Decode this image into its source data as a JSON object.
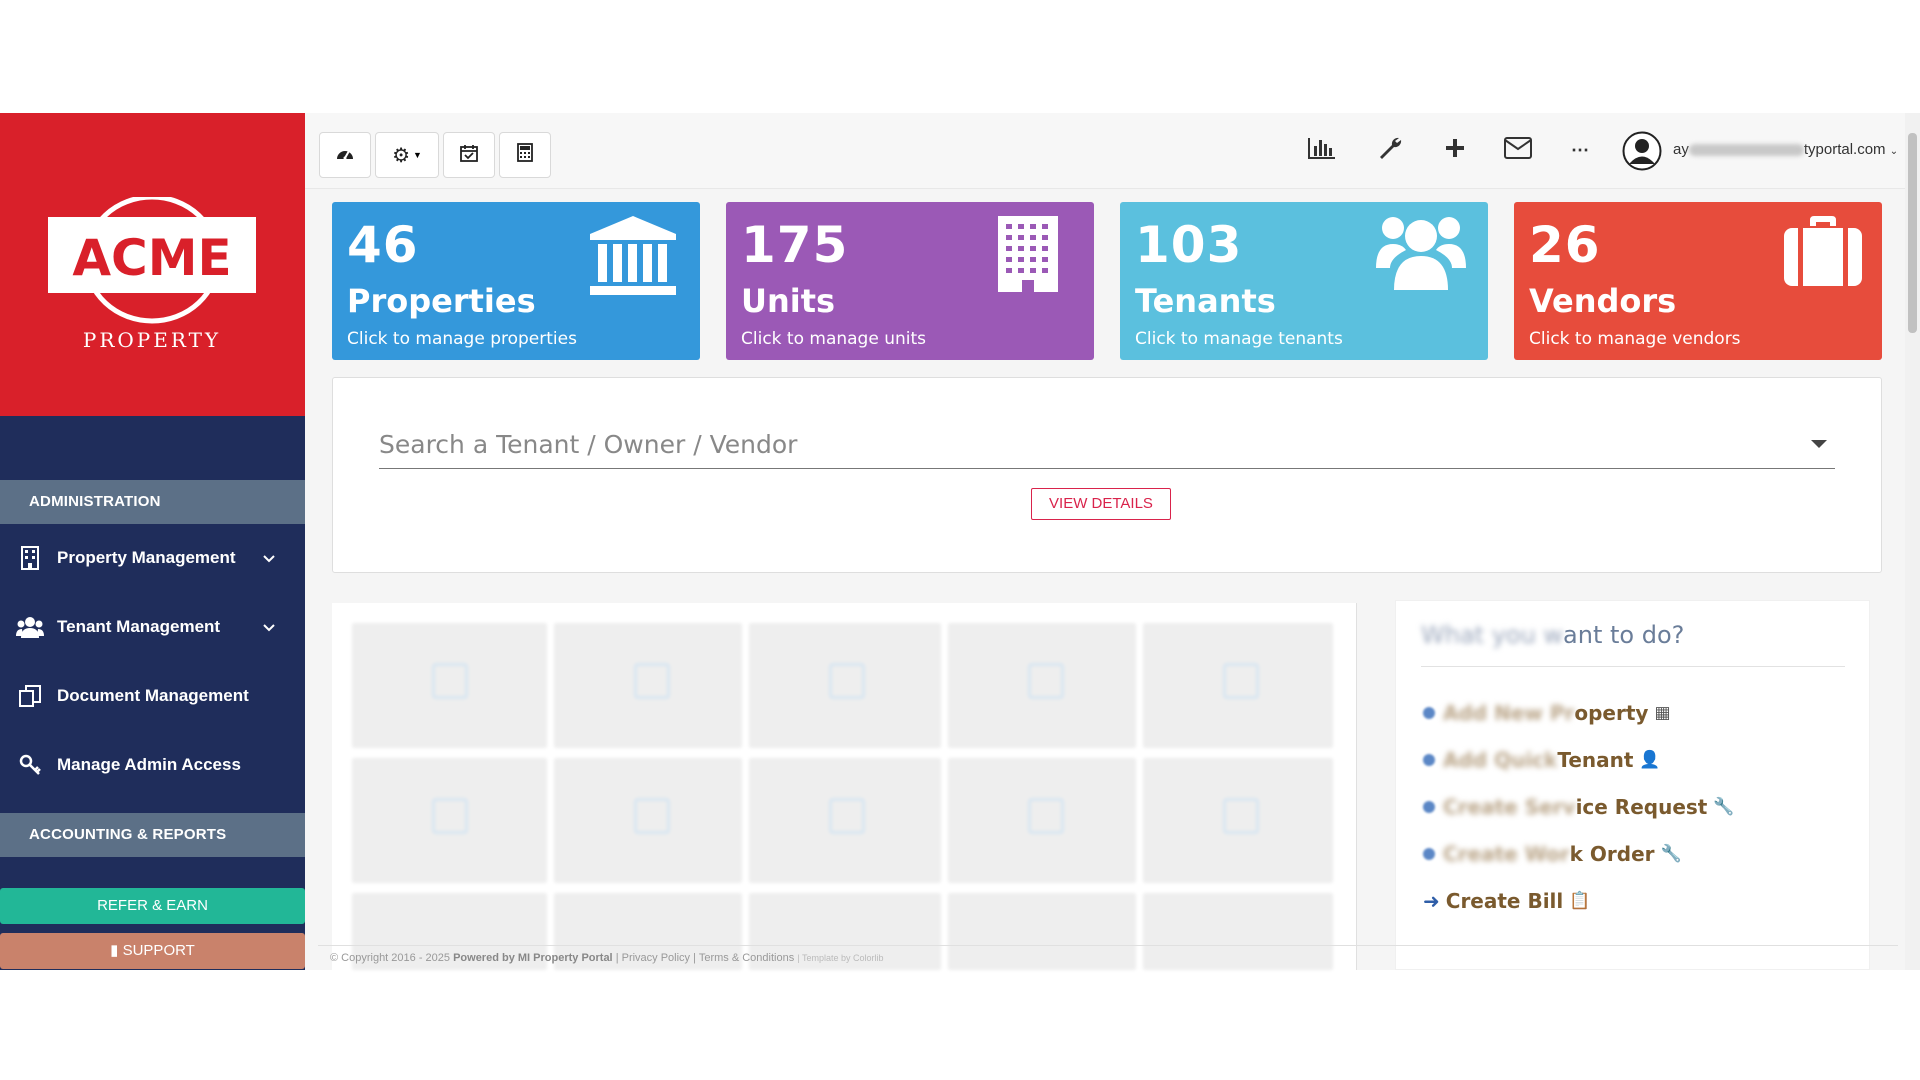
{
  "brand": {
    "logo_text": "ACME",
    "logo_sub": "PROPERTY",
    "red": "#d9202a",
    "navy": "#1f2d5b"
  },
  "sidebar": {
    "section_admin": "ADMINISTRATION",
    "items": [
      {
        "label": "Property Management",
        "icon": "building-icon",
        "has_chevron": true
      },
      {
        "label": "Tenant Management",
        "icon": "users-icon",
        "has_chevron": true
      },
      {
        "label": "Document Management",
        "icon": "documents-icon",
        "has_chevron": false
      },
      {
        "label": "Manage Admin Access",
        "icon": "key-icon",
        "has_chevron": false
      }
    ],
    "section_accounting": "ACCOUNTING & REPORTS",
    "refer_label": "REFER & EARN",
    "support_label": "SUPPORT",
    "refer_color": "#22b797",
    "support_color": "#c9826b"
  },
  "topbar": {
    "left_buttons": [
      "dashboard-icon",
      "settings-dropdown-icon",
      "calendar-icon",
      "calculator-icon"
    ],
    "right_icons": [
      "chart-icon",
      "wrench-icon",
      "plus-icon",
      "mail-icon",
      "more-icon"
    ],
    "user_email_prefix": "ay",
    "user_email_suffix": "typortal.com"
  },
  "cards": [
    {
      "count": "46",
      "title": "Properties",
      "subtitle": "Click to manage properties",
      "color": "#3498db",
      "icon": "bank-icon"
    },
    {
      "count": "175",
      "title": "Units",
      "subtitle": "Click to manage units",
      "color": "#9b59b6",
      "icon": "building-grid-icon"
    },
    {
      "count": "103",
      "title": "Tenants",
      "subtitle": "Click to manage tenants",
      "color": "#5bc0de",
      "icon": "users-icon"
    },
    {
      "count": "26",
      "title": "Vendors",
      "subtitle": "Click to manage vendors",
      "color": "#e74c3c",
      "icon": "briefcase-icon"
    }
  ],
  "search": {
    "placeholder": "Search a Tenant / Owner / Vendor",
    "button_label": "VIEW DETAILS"
  },
  "actions": {
    "title_blurred": "What you w",
    "title_visible": "ant to do?",
    "items": [
      {
        "blurred": "Add New Pr",
        "visible": "operty",
        "icon": "▦"
      },
      {
        "blurred": "Add Quick ",
        "visible": "Tenant",
        "icon": "👤"
      },
      {
        "blurred": "Create Serv",
        "visible": "ice Request",
        "icon": "🔧"
      },
      {
        "blurred": "Create Wor",
        "visible": "k Order",
        "icon": "🔧"
      },
      {
        "blurred": "",
        "visible": "Create Bill",
        "icon": "📋"
      }
    ]
  },
  "footer": {
    "copyright": "© Copyright 2016 - 2025",
    "powered": "Powered by MI Property Portal",
    "links": "| Privacy Policy | Terms & Conditions",
    "template": "| Template by Colorlib"
  }
}
